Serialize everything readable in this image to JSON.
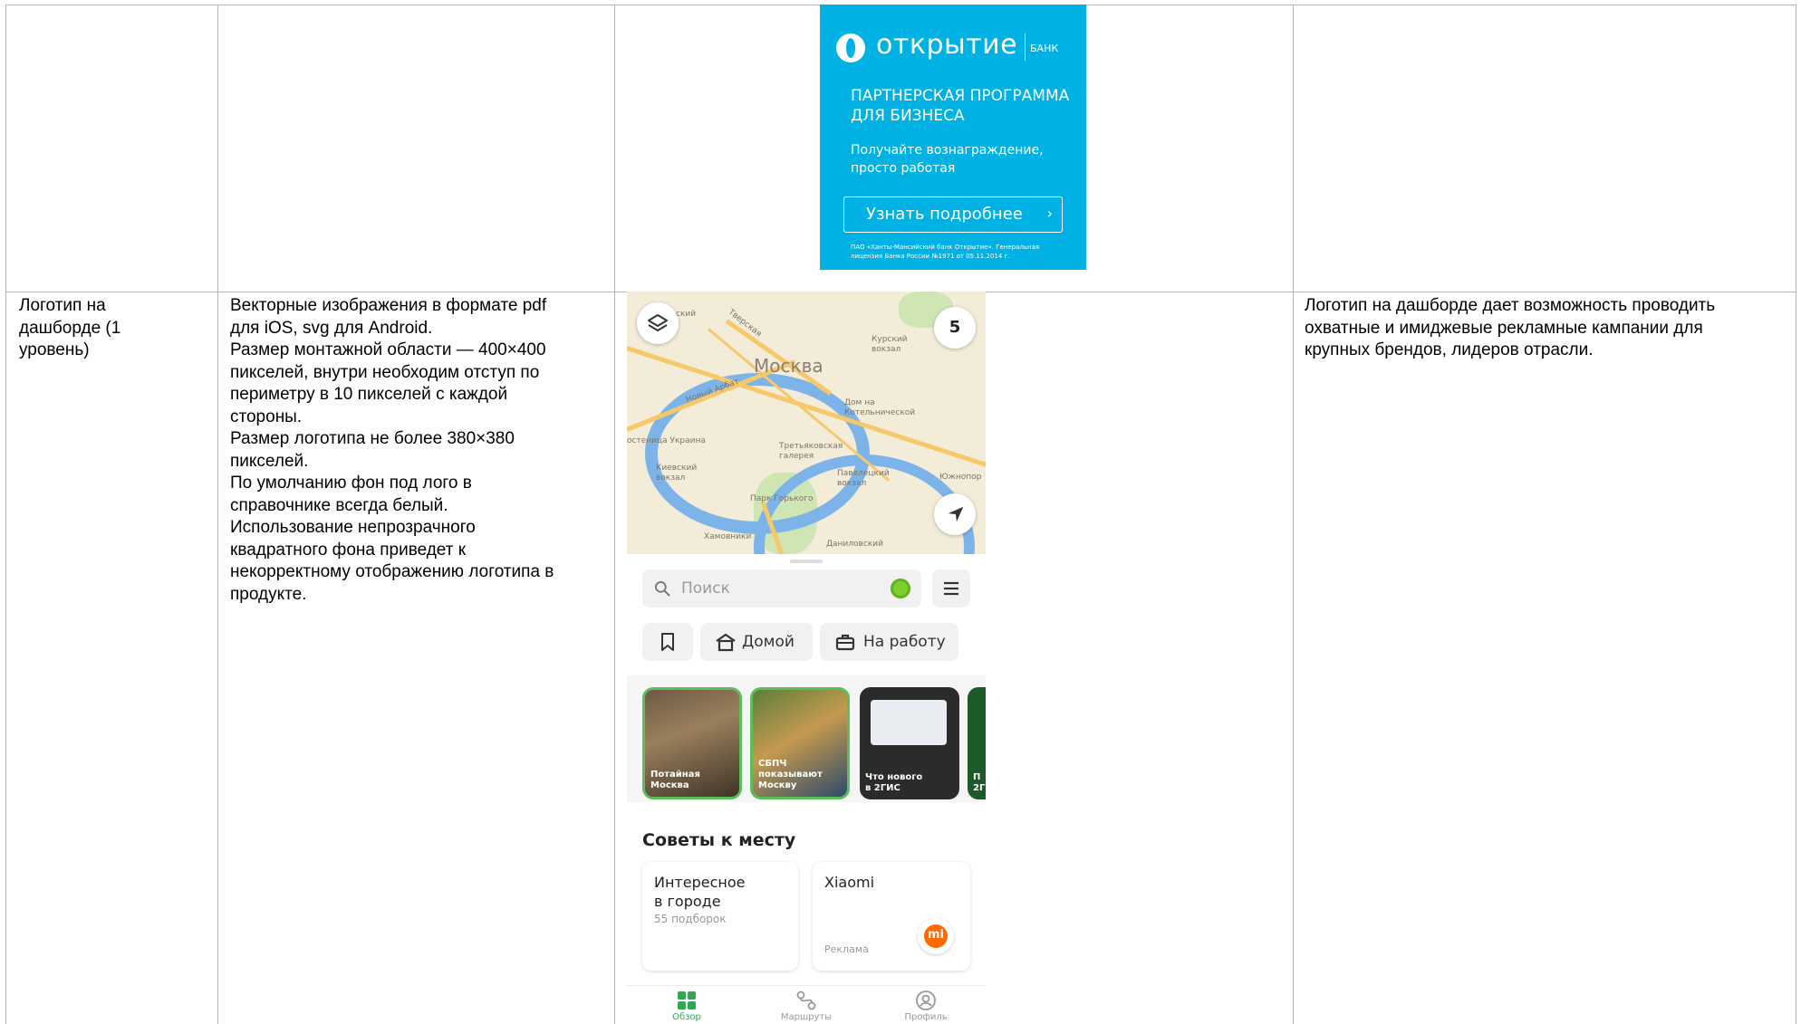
{
  "banner": {
    "brand": "открытие",
    "bank": "БАНК",
    "heading": "ПАРТНЕРСКАЯ ПРОГРАММА\nДЛЯ БИЗНЕСА",
    "subheading": "Получайте вознаграждение,\nпросто работая",
    "button_label": "Узнать подробнее",
    "fineprint": "ПАО «Ханты-Мансийский банк Открытие». Генеральная\nлицензия Банка России №1971 от 05.11.2014 г."
  },
  "row": {
    "name": "Логотип на\nдашборде (1\nуровень)",
    "requirements": "Векторные изображения в формате pdf\nдля iOS, svg для Android.\nРазмер монтажной области — 400×400\nпикселей, внутри необходим отступ по\nпериметру в 10 пикселей с каждой\nстороны.\nРазмер логотипа не более 380×380\nпикселей.\nПо умолчанию фон под лого в\nсправочнике всегда белый.\nИспользование непрозрачного\nквадратного фона приведет к\nнекорректному отображению логотипа в\nпродукте.",
    "description": "Логотип на дашборде дает возможность проводить\nохватные и имиджевые рекламные кампании для\nкрупных брендов, лидеров отрасли."
  },
  "phone": {
    "map": {
      "city": "Москва",
      "counter": "5",
      "labels": [
        "Курский\nвокзал",
        "Новый Арбат",
        "Тверская",
        "Дом на\nКотельнической",
        "Третьяковская\nгалерея",
        "Павелецкий\nвокзал",
        "Киевский\nвокзал",
        "Парк Горького",
        "Хамовники",
        "Даниловский",
        "Южнопор",
        "остеница Украина",
        "ский"
      ]
    },
    "search_placeholder": "Поиск",
    "chips": [
      "Домой",
      "На работу"
    ],
    "stories": [
      "Потайная\nМосква",
      "СБПЧ\nпоказывают\nМоскву",
      "Что нового\nв 2ГИС",
      "П\n2Г"
    ],
    "section_title": "Советы к месту",
    "cards": [
      {
        "title": "Интересное\nв городе",
        "sub": "55 подборок"
      },
      {
        "title": "Xiaomi",
        "ad": "Реклама",
        "logo": "mi"
      }
    ],
    "tabs": [
      "Обзор",
      "Маршруты",
      "Профиль"
    ],
    "colors": {
      "accent": "#2fa84f",
      "banner": "#00b1e3",
      "xiaomi": "#ff6900"
    }
  }
}
